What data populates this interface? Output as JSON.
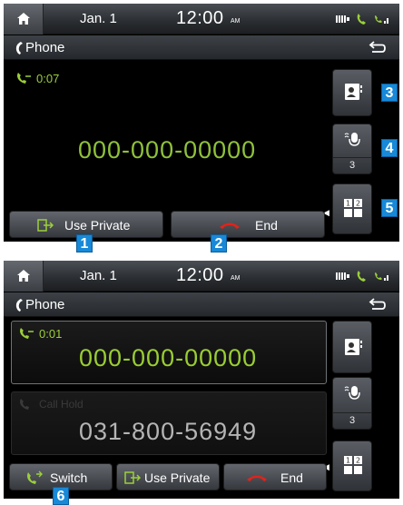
{
  "status_bar": {
    "date": "Jan.  1",
    "time": "12:00",
    "ampm": "AM"
  },
  "title_bar": {
    "title": "Phone"
  },
  "screen1": {
    "call_timer": "0:07",
    "phone_number": "000-000-00000",
    "mic_volume": "3",
    "buttons": {
      "use_private": "Use Private",
      "end": "End"
    },
    "callouts": [
      "1",
      "2",
      "3",
      "4",
      "5"
    ]
  },
  "screen2": {
    "active_call": {
      "timer": "0:01",
      "number": "000-000-00000"
    },
    "held_call": {
      "status": "Call Hold",
      "number": "031-800-56949"
    },
    "mic_volume": "3",
    "buttons": {
      "switch": "Switch",
      "use_private": "Use Private",
      "end": "End"
    },
    "callouts": [
      "6"
    ]
  },
  "icons": {
    "home": "home-icon",
    "back": "back-arrow-icon",
    "handset": "handset-icon",
    "battery": "battery-icon",
    "bluetooth_call": "bluetooth-call-icon",
    "signal": "signal-icon",
    "contacts": "contacts-icon",
    "mic": "mic-icon",
    "keypad": "keypad-icon",
    "use_private": "use-private-icon",
    "end": "end-call-icon",
    "switch": "switch-icon"
  },
  "colors": {
    "number_green": "#8fc13a",
    "end_red": "#e0231b",
    "callout_blue": "#1789d8"
  }
}
